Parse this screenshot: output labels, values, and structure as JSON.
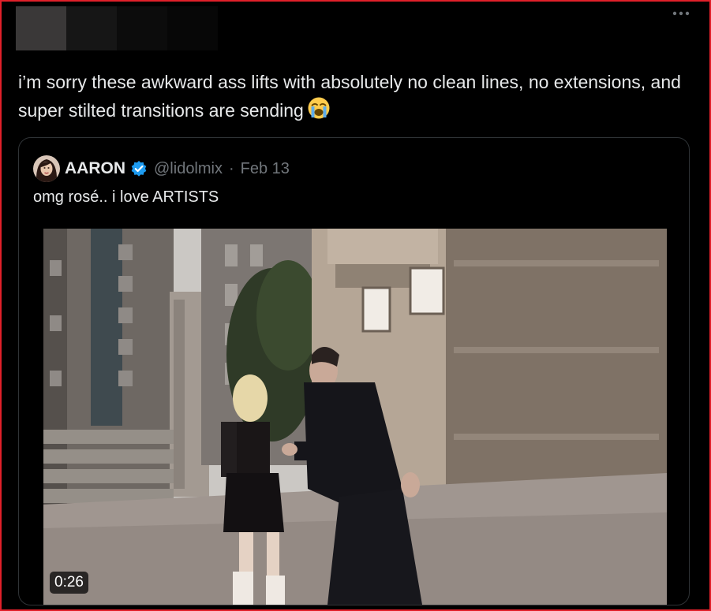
{
  "tweet": {
    "text": "i’m sorry these awkward ass lifts with absolutely no clean lines, no extensions, and super stilted transitions are sending",
    "emoji_icon": "loudly-crying-face"
  },
  "quoted": {
    "name": "AARON",
    "verified": true,
    "handle": "@lidolmix",
    "separator": "·",
    "date": "Feb 13",
    "text": "omg rosé.. i love ARTISTS",
    "video": {
      "duration": "0:26"
    }
  },
  "colors": {
    "background": "#000000",
    "text": "#e7e9ea",
    "muted": "#71767b",
    "verified": "#1d9bf0",
    "border": "#2f3336",
    "frame_outline": "#e0202a"
  }
}
